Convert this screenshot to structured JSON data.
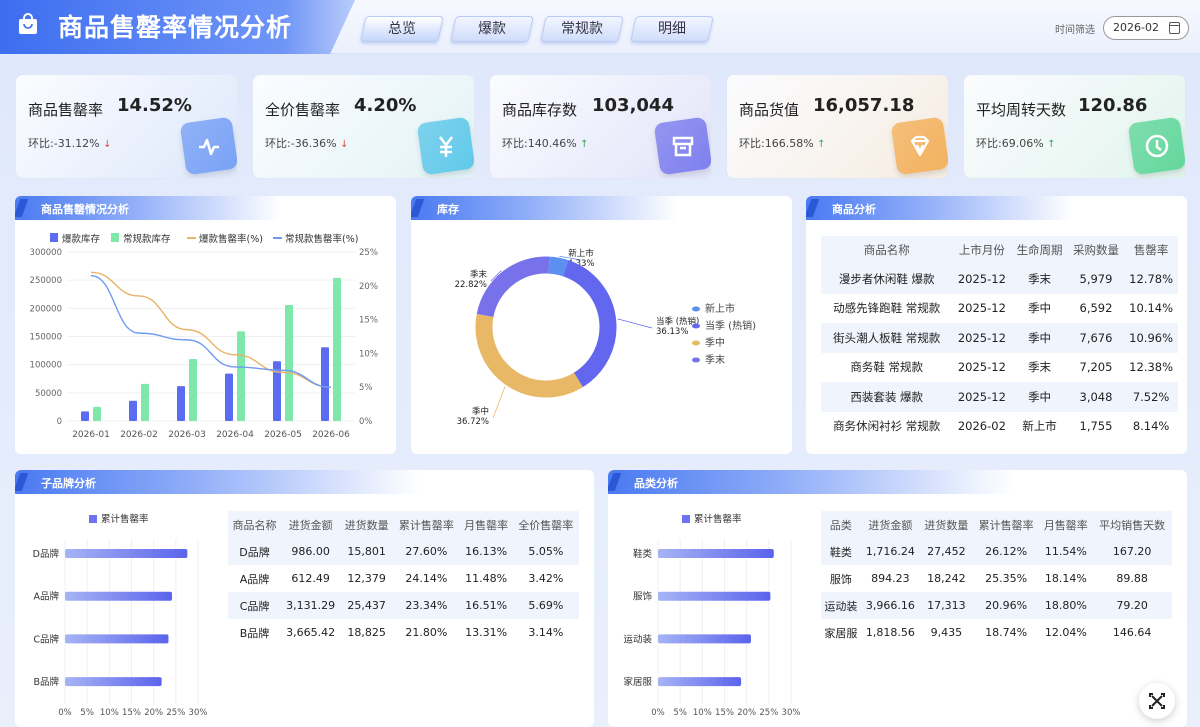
{
  "header": {
    "title": "商品售罄率情况分析",
    "tabs": [
      "总览",
      "爆款",
      "常规款",
      "明细"
    ],
    "time_label": "时间筛选",
    "date_value": "2026-02"
  },
  "kpis": [
    {
      "label": "商品售罄率",
      "value": "14.52%",
      "change_label": "环比:",
      "change": "-31.12%",
      "trend": "down",
      "color": "#dde8fb",
      "icon_color": "#7aa2f5",
      "icon": "pulse-icon"
    },
    {
      "label": "全价售罄率",
      "value": "4.20%",
      "change_label": "环比:",
      "change": "-36.36%",
      "trend": "down",
      "color": "#e2f3f6",
      "icon_color": "#62c9ea",
      "icon": "yen-icon"
    },
    {
      "label": "商品库存数",
      "value": "103,044",
      "change_label": "环比:",
      "change": "140.46%",
      "trend": "up",
      "color": "#e2e3f9",
      "icon_color": "#7f80ee",
      "icon": "box-icon"
    },
    {
      "label": "商品货值",
      "value": "16,057.18",
      "change_label": "环比:",
      "change": "166.58%",
      "trend": "up",
      "color": "#f6ece1",
      "icon_color": "#f3b25f",
      "icon": "diamond-icon"
    },
    {
      "label": "平均周转天数",
      "value": "120.86",
      "change_label": "环比:",
      "change": "69.06%",
      "trend": "up",
      "color": "#e1f4ec",
      "icon_color": "#64d79d",
      "icon": "clock-icon"
    }
  ],
  "panels": {
    "sell": "商品售罄情况分析",
    "stock": "库存",
    "product": "商品分析",
    "brand": "子品牌分析",
    "category": "品类分析"
  },
  "chart_data": [
    {
      "type": "bar",
      "title": "商品售罄情况分析",
      "categories": [
        "2026-01",
        "2026-02",
        "2026-03",
        "2026-04",
        "2026-05",
        "2026-06"
      ],
      "series": [
        {
          "name": "爆款库存",
          "axis": "left",
          "values": [
            17000,
            36000,
            62000,
            84000,
            106000,
            131000
          ],
          "color": "#5b6cf0"
        },
        {
          "name": "常规款库存",
          "axis": "left",
          "values": [
            25000,
            66000,
            110000,
            159000,
            206000,
            254000
          ],
          "color": "#7ee8a8"
        },
        {
          "name": "爆款售罄率(%)",
          "axis": "right",
          "type": "line",
          "values": [
            22,
            18.5,
            13.5,
            9.8,
            7.2,
            5
          ],
          "color": "#eab36a"
        },
        {
          "name": "常规款售罄率(%)",
          "axis": "right",
          "type": "line",
          "values": [
            21.5,
            13,
            12,
            8,
            7.5,
            5
          ],
          "color": "#6e9af0"
        }
      ],
      "ylim_left": [
        0,
        300000
      ],
      "yticks_left": [
        "0",
        "50000",
        "100000",
        "150000",
        "200000",
        "250000",
        "300000"
      ],
      "ylim_right": [
        0,
        25
      ],
      "yticks_right": [
        "0%",
        "5%",
        "10%",
        "15%",
        "20%",
        "25%"
      ],
      "legend": "top"
    },
    {
      "type": "pie",
      "title": "库存",
      "slices": [
        {
          "name": "新上市",
          "value": 4.33,
          "label": "4.33%",
          "color": "#5b8ff0"
        },
        {
          "name": "当季 (热销)",
          "value": 36.13,
          "label": "36.13%",
          "color": "#6366ef"
        },
        {
          "name": "季中",
          "value": 36.72,
          "label": "36.72%",
          "color": "#e8b866"
        },
        {
          "name": "季末",
          "value": 22.82,
          "label": "22.82%",
          "color": "#7872ea"
        }
      ],
      "legend": "right"
    },
    {
      "type": "bar",
      "orientation": "horizontal",
      "title": "子品牌分析",
      "series": [
        {
          "name": "累计售罄率",
          "values": [
            27.6,
            24.14,
            23.34,
            21.8
          ]
        }
      ],
      "categories": [
        "D品牌",
        "A品牌",
        "C品牌",
        "B品牌"
      ],
      "xlim": [
        0,
        30
      ],
      "xticks": [
        "0%",
        "5%",
        "10%",
        "15%",
        "20%",
        "25%",
        "30%"
      ]
    },
    {
      "type": "bar",
      "orientation": "horizontal",
      "title": "品类分析",
      "series": [
        {
          "name": "累计售罄率",
          "values": [
            26.12,
            25.35,
            20.96,
            18.74
          ]
        }
      ],
      "categories": [
        "鞋类",
        "服饰",
        "运动装",
        "家居服"
      ],
      "xlim": [
        0,
        30
      ],
      "xticks": [
        "0%",
        "5%",
        "10%",
        "15%",
        "20%",
        "25%",
        "30%"
      ]
    }
  ],
  "product_table": {
    "headers": [
      "商品名称",
      "上市月份",
      "生命周期",
      "采购数量",
      "售罄率"
    ],
    "rows": [
      [
        "漫步者休闲鞋 爆款",
        "2025-12",
        "季末",
        "5,979",
        "12.78%"
      ],
      [
        "动感先锋跑鞋 常规款",
        "2025-12",
        "季中",
        "6,592",
        "10.14%"
      ],
      [
        "街头潮人板鞋 常规款",
        "2025-12",
        "季中",
        "7,676",
        "10.96%"
      ],
      [
        "商务鞋 常规款",
        "2025-12",
        "季末",
        "7,205",
        "12.38%"
      ],
      [
        "西装套装 爆款",
        "2025-12",
        "季中",
        "3,048",
        "7.52%"
      ],
      [
        "商务休闲衬衫 常规款",
        "2026-02",
        "新上市",
        "1,755",
        "8.14%"
      ]
    ]
  },
  "brand_table": {
    "headers": [
      "商品名称",
      "进货金额",
      "进货数量",
      "累计售罄率",
      "月售罄率",
      "全价售罄率"
    ],
    "rows": [
      [
        "D品牌",
        "986.00",
        "15,801",
        "27.60%",
        "16.13%",
        "5.05%"
      ],
      [
        "A品牌",
        "612.49",
        "12,379",
        "24.14%",
        "11.48%",
        "3.42%"
      ],
      [
        "C品牌",
        "3,131.29",
        "25,437",
        "23.34%",
        "16.51%",
        "5.69%"
      ],
      [
        "B品牌",
        "3,665.42",
        "18,825",
        "21.80%",
        "13.31%",
        "3.14%"
      ]
    ]
  },
  "category_table": {
    "headers": [
      "品类",
      "进货金额",
      "进货数量",
      "累计售罄率",
      "月售罄率",
      "平均销售天数"
    ],
    "rows": [
      [
        "鞋类",
        "1,716.24",
        "27,452",
        "26.12%",
        "11.54%",
        "167.20"
      ],
      [
        "服饰",
        "894.23",
        "18,242",
        "25.35%",
        "18.14%",
        "89.88"
      ],
      [
        "运动装",
        "3,966.16",
        "17,313",
        "20.96%",
        "18.80%",
        "79.20"
      ],
      [
        "家居服",
        "1,818.56",
        "9,435",
        "18.74%",
        "12.04%",
        "146.64"
      ]
    ]
  }
}
